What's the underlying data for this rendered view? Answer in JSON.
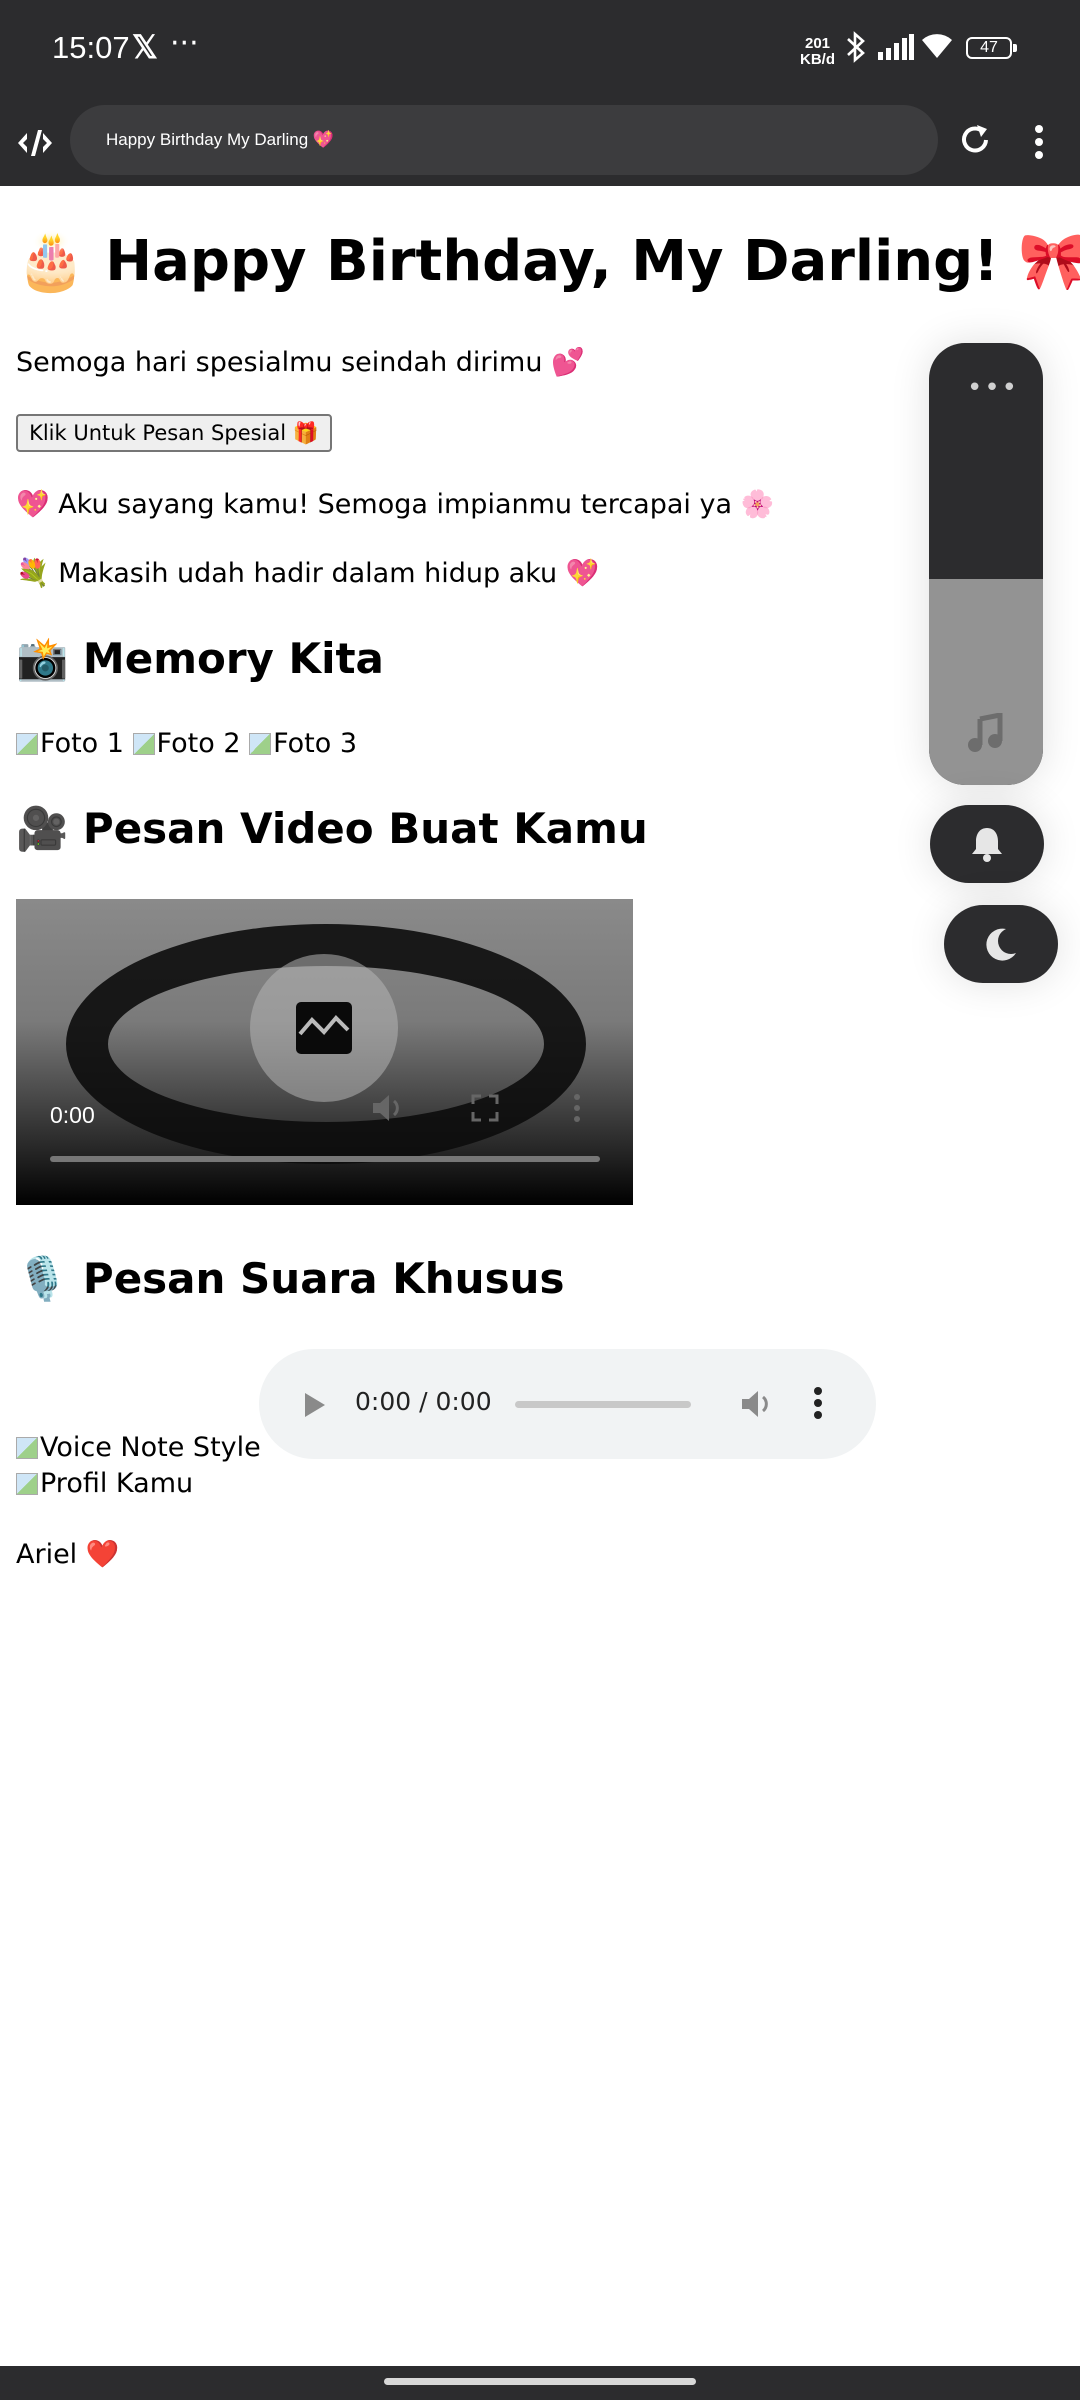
{
  "status_bar": {
    "time": "15:07",
    "x_app": "𝕏",
    "more": "···",
    "net_speed_value": "201",
    "net_speed_unit": "KB/d",
    "battery": "47"
  },
  "browser": {
    "tab_title": "Happy Birthday My Darling 💖"
  },
  "page": {
    "title": "🎂 Happy Birthday, My Darling! 🎀",
    "greeting": "Semoga hari spesialmu seindah dirimu 💕",
    "special_button": "Klik Untuk Pesan Spesial 🎁",
    "line1": "💖 Aku sayang kamu! Semoga impianmu tercapai ya 🌸",
    "line2": "💐 Makasih udah hadir dalam hidup aku 💖",
    "memory_heading": "📸 Memory Kita",
    "photos": [
      "Foto 1",
      "Foto 2",
      "Foto 3"
    ],
    "video_heading": "🎥 Pesan Video Buat Kamu",
    "video_time": "0:00",
    "voice_heading": "🎙️ Pesan Suara Khusus",
    "audio_time": "0:00 / 0:00",
    "voice_note_alt": "Voice Note Style",
    "profile_alt": "Profil Kamu",
    "signature": "Ariel ❤️"
  },
  "side_controls": {
    "more": "•••",
    "icons": [
      "music-icon",
      "bell-icon",
      "moon-icon"
    ]
  },
  "colors": {
    "system_bar": "#2c2c2e",
    "url_field": "#3c3c3e",
    "audio_bg": "#f1f3f4"
  }
}
